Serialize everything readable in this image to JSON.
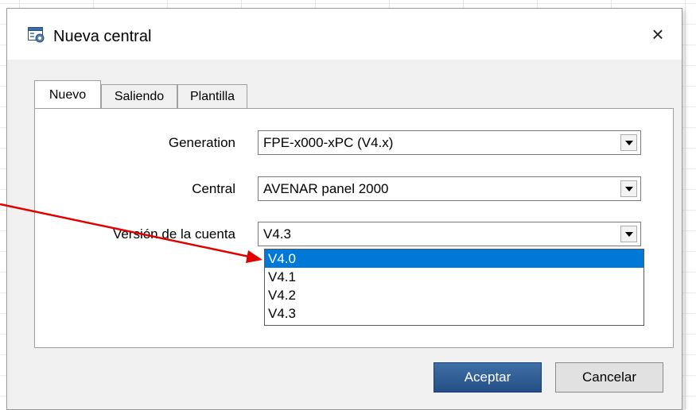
{
  "dialog": {
    "title": "Nueva central",
    "close_glyph": "×"
  },
  "tabs": [
    {
      "label": "Nuevo",
      "active": true
    },
    {
      "label": "Saliendo",
      "active": false
    },
    {
      "label": "Plantilla",
      "active": false
    }
  ],
  "form": {
    "generation": {
      "label": "Generation",
      "value": "FPE-x000-xPC (V4.x)"
    },
    "central": {
      "label": "Central",
      "value": "AVENAR panel 2000"
    },
    "version": {
      "label": "Versión de la cuenta",
      "value": "V4.3"
    }
  },
  "version_options": [
    "V4.0",
    "V4.1",
    "V4.2",
    "V4.3"
  ],
  "highlighted_option": "V4.0",
  "buttons": {
    "accept": "Aceptar",
    "cancel": "Cancelar"
  },
  "colors": {
    "selection": "#0078d7",
    "annotation_arrow": "#e00000",
    "accept_button": "#2c5a92"
  }
}
